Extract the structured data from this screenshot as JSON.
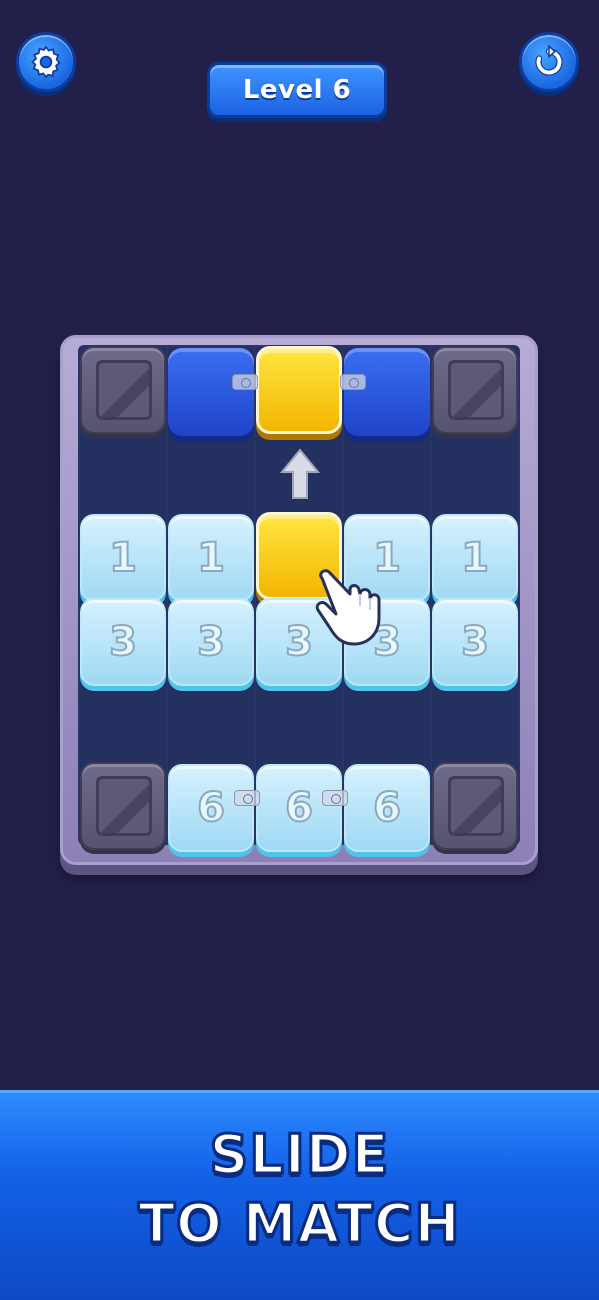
{
  "header": {
    "level_label": "Level 6",
    "settings_icon": "gear-icon",
    "restart_icon": "restart-icon"
  },
  "board": {
    "rows": [
      [
        "crate",
        "blue",
        "yellow",
        "blue",
        "crate"
      ],
      [
        "empty",
        "empty",
        "empty",
        "empty",
        "empty"
      ],
      [
        "ice-1",
        "ice-1",
        "yellow",
        "ice-1",
        "ice-1"
      ],
      [
        "ice-3",
        "ice-3",
        "ice-3",
        "ice-3",
        "ice-3"
      ],
      [
        "empty",
        "empty",
        "empty",
        "empty",
        "empty"
      ],
      [
        "crate",
        "ice-6",
        "ice-6",
        "ice-6",
        "crate"
      ]
    ],
    "ice_numbers": {
      "row3": [
        "1",
        "1",
        "1",
        "1"
      ],
      "row4": [
        "3",
        "3",
        "3",
        "3",
        "3"
      ],
      "row6": [
        "6",
        "6",
        "6"
      ]
    },
    "hint": {
      "arrow_icon": "arrow-up-icon",
      "hand_icon": "pointing-hand-icon"
    }
  },
  "banner": {
    "line1": "SLIDE",
    "line2": "TO MATCH"
  },
  "colors": {
    "background": "#22204a",
    "accent_blue": "#1b62e4",
    "yellow_tile": "#ffe640",
    "ice_tile": "#bfe8f9"
  }
}
